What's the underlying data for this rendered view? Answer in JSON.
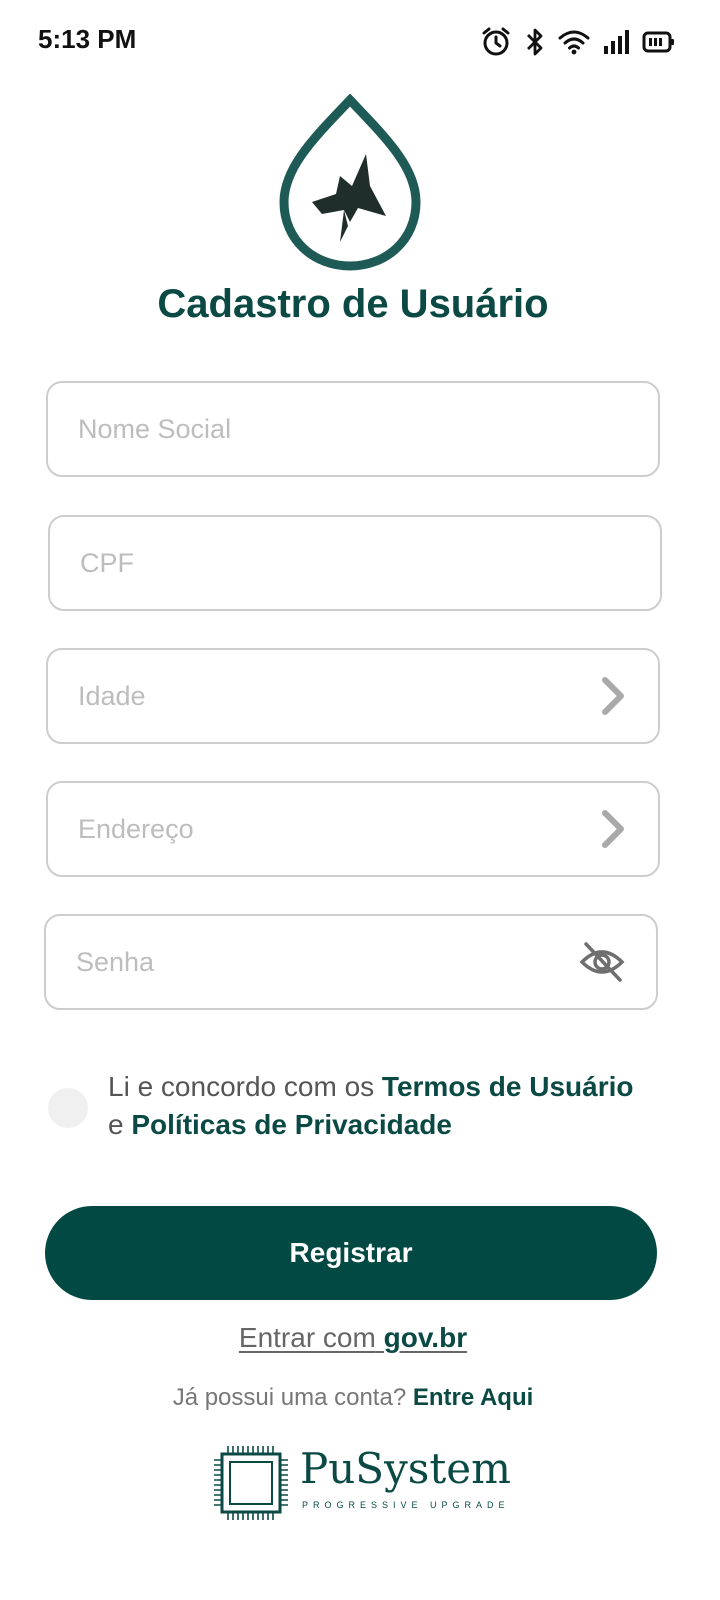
{
  "status_bar": {
    "time": "5:13 PM",
    "icons": [
      "alarm-icon",
      "bluetooth-icon",
      "wifi-icon",
      "signal-icon",
      "battery-icon"
    ]
  },
  "logo_icon": "drop-with-bird-logo",
  "title": "Cadastro de Usuário",
  "fields": {
    "nome_social": {
      "placeholder": "Nome Social",
      "value": ""
    },
    "cpf": {
      "placeholder": "CPF",
      "value": ""
    },
    "idade": {
      "placeholder": "Idade",
      "value": "",
      "trailing_icon": "chevron-right-icon"
    },
    "endereco": {
      "placeholder": "Endereço",
      "value": "",
      "trailing_icon": "chevron-right-icon"
    },
    "senha": {
      "placeholder": "Senha",
      "value": "",
      "trailing_icon": "eye-off-icon"
    }
  },
  "terms": {
    "prefix": "Li e concordo com os",
    "terms_link": "Termos de Usuário",
    "connector": "e",
    "privacy_link": "Políticas de Privacidade",
    "checked": false
  },
  "register_button": "Registrar",
  "govbr": {
    "prefix": "Entrar com",
    "brand": "gov.br"
  },
  "login": {
    "question": "Já possui uma conta?",
    "link": "Entre Aqui"
  },
  "brand": {
    "name": "PuSystem",
    "tagline": "PROGRESSIVE UPGRADE"
  },
  "colors": {
    "primary": "#034943",
    "title": "#0b4a44",
    "border": "#cdcdcd",
    "placeholder": "#bdbdbd"
  }
}
